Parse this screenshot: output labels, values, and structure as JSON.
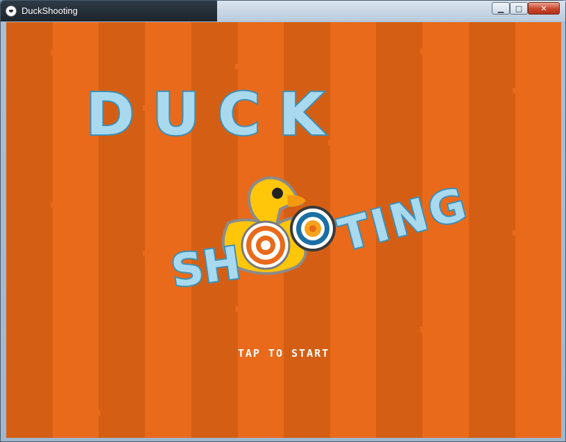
{
  "window": {
    "title": "DuckShooting",
    "app_icon": "kivy-icon",
    "controls": {
      "minimize": "minimize-icon",
      "maximize": "maximize-icon",
      "close": "close-icon"
    }
  },
  "game": {
    "logo": {
      "word1": "DUCK",
      "word2_prefix": "SH",
      "word2_suffix": "TING"
    },
    "prompt": "TAP TO START",
    "colors": {
      "background": "#e96a1a",
      "stripe": "#d45f14",
      "logo_fill": "#a9d9ee",
      "logo_outline": "#3f8fb5",
      "duck": "#ffc60a",
      "beak": "#f39a12",
      "target_orange": "#e96a1a",
      "target_blue": "#1b6fa3"
    }
  }
}
